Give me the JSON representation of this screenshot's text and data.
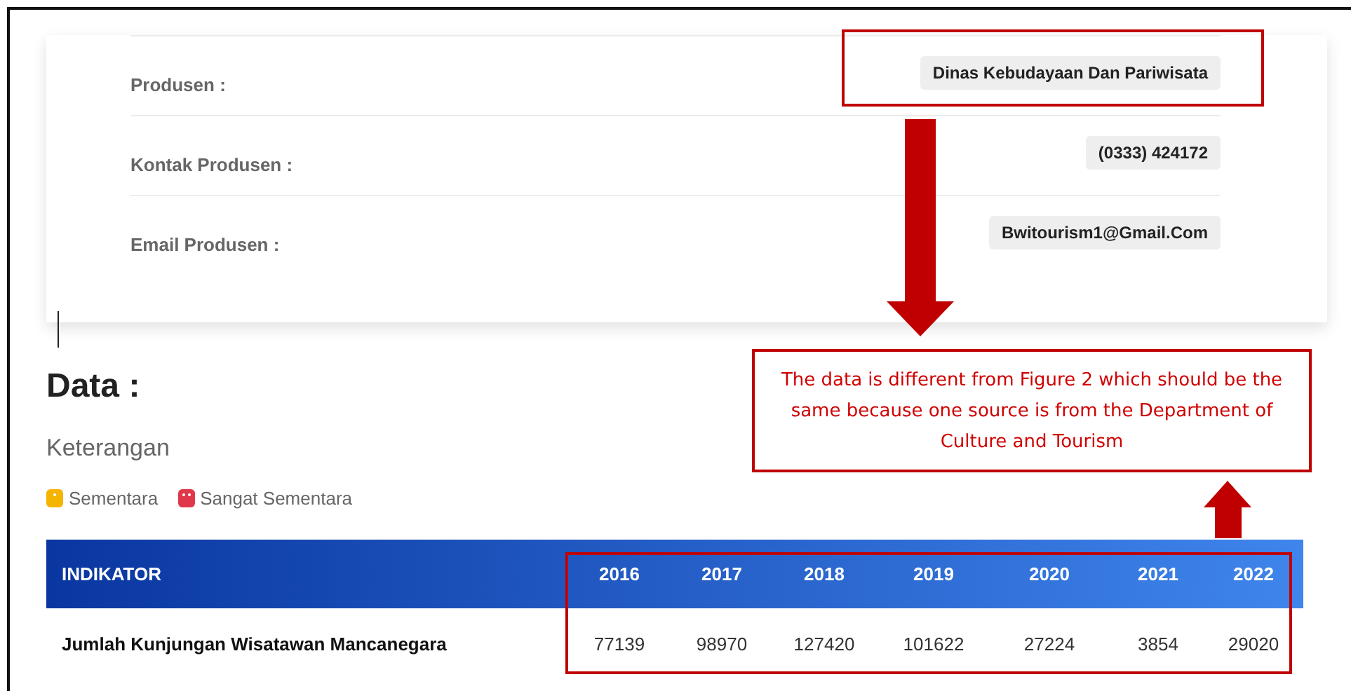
{
  "producer_fields": [
    {
      "label": "Produsen :",
      "value": "Dinas Kebudayaan Dan Pariwisata"
    },
    {
      "label": "Kontak Produsen :",
      "value": "(0333) 424172"
    },
    {
      "label": "Email Produsen :",
      "value": "Bwitourism1@Gmail.Com"
    }
  ],
  "data_heading": "Data :",
  "legend_title": "Keterangan",
  "legend": [
    {
      "label": "Sementara",
      "color": "#f5b400",
      "kind": "single"
    },
    {
      "label": "Sangat Sementara",
      "color": "#e0384a",
      "kind": "double"
    }
  ],
  "table": {
    "columns": [
      "INDIKATOR",
      "2016",
      "2017",
      "2018",
      "2019",
      "2020",
      "2021",
      "2022"
    ],
    "rows": [
      [
        "Jumlah Kunjungan Wisatawan Mancanegara",
        "77139",
        "98970",
        "127420",
        "101622",
        "27224",
        "3854",
        "29020"
      ]
    ]
  },
  "annotation": {
    "callout": "The data is different from Figure 2 which should be the same because one source is from the Department of Culture and Tourism"
  }
}
